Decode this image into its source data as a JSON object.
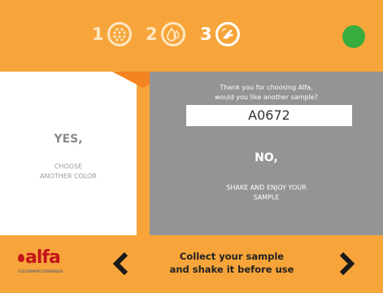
{
  "steps": [
    {
      "number": "1",
      "icon": "dots-grid-icon"
    },
    {
      "number": "2",
      "icon": "drops-icon"
    },
    {
      "number": "3",
      "icon": "hand-shake-icon"
    }
  ],
  "status": {
    "color": "#36ad3e"
  },
  "yes_panel": {
    "title": "YES,",
    "subtitle": "CHOOSE\nANOTHER COLOR"
  },
  "no_panel": {
    "prompt": "Thank you for choosing Alfa,\nwould you like another sample?",
    "code": "A0672",
    "title": "NO,",
    "subtitle": "SHAKE AND ENJOY YOUR\nSAMPLE"
  },
  "footer": {
    "logo_text": "alfa",
    "logo_subtitle": "COLORPAINT DISPENSER",
    "message": "Collect your sample\nand shake it before use",
    "prev_icon": "chevron-left-icon",
    "next_icon": "chevron-right-icon"
  },
  "colors": {
    "accent": "#f7a53a",
    "dark_accent": "#f5831f",
    "panel_gray": "#949494",
    "brand_red": "#c4141c"
  }
}
